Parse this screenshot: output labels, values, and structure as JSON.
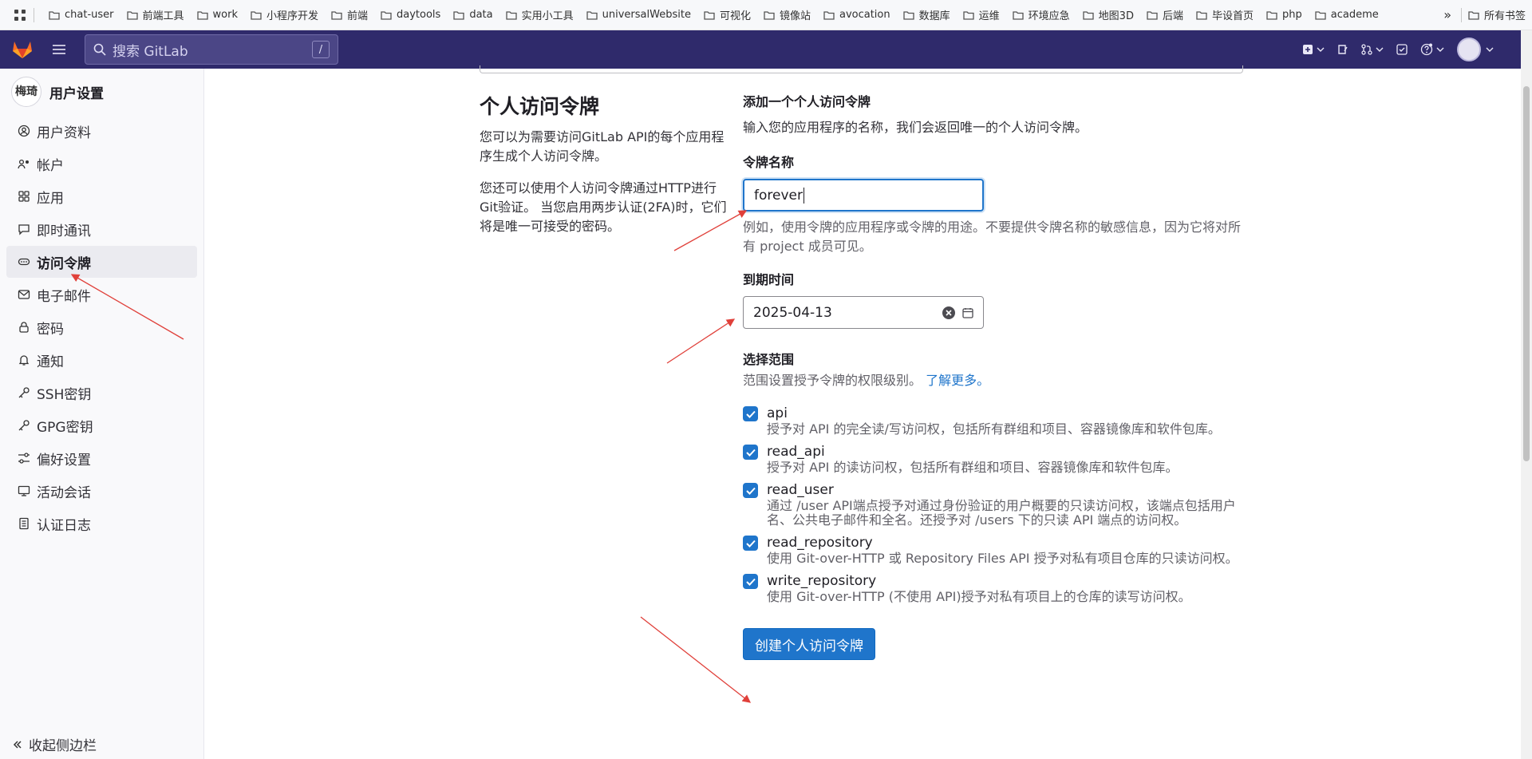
{
  "bookmarks": {
    "items": [
      "chat-user",
      "前端工具",
      "work",
      "小程序开发",
      "前端",
      "daytools",
      "data",
      "实用小工具",
      "universalWebsite",
      "可视化",
      "镜像站",
      "avocation",
      "数据库",
      "运维",
      "环境应急",
      "地图3D",
      "后端",
      "毕设首页",
      "php",
      "academe"
    ],
    "all_label": "所有书签"
  },
  "header": {
    "search_placeholder": "搜索 GitLab",
    "search_shortcut": "/"
  },
  "sidebar": {
    "avatar_text": "梅琦",
    "title": "用户设置",
    "items": [
      {
        "label": "用户资料",
        "icon": "profile-icon"
      },
      {
        "label": "帐户",
        "icon": "account-icon"
      },
      {
        "label": "应用",
        "icon": "applications-icon"
      },
      {
        "label": "即时通讯",
        "icon": "chat-icon"
      },
      {
        "label": "访问令牌",
        "icon": "token-icon",
        "active": true
      },
      {
        "label": "电子邮件",
        "icon": "mail-icon"
      },
      {
        "label": "密码",
        "icon": "lock-icon"
      },
      {
        "label": "通知",
        "icon": "bell-icon"
      },
      {
        "label": "SSH密钥",
        "icon": "key-icon"
      },
      {
        "label": "GPG密钥",
        "icon": "key-icon"
      },
      {
        "label": "偏好设置",
        "icon": "preferences-icon"
      },
      {
        "label": "活动会话",
        "icon": "monitor-icon"
      },
      {
        "label": "认证日志",
        "icon": "log-icon"
      }
    ],
    "collapse_label": "收起侧边栏"
  },
  "intro": {
    "title": "个人访问令牌",
    "p1": "您可以为需要访问GitLab API的每个应用程序生成个人访问令牌。",
    "p2": "您还可以使用个人访问令牌通过HTTP进行Git验证。 当您启用两步认证(2FA)时，它们将是唯一可接受的密码。"
  },
  "form": {
    "title": "添加一个个人访问令牌",
    "desc": "输入您的应用程序的名称，我们会返回唯一的个人访问令牌。",
    "name_label": "令牌名称",
    "name_value": "forever",
    "name_hint": "例如，使用令牌的应用程序或令牌的用途。不要提供令牌名称的敏感信息，因为它将对所有 project 成员可见。",
    "expiry_label": "到期时间",
    "expiry_value": "2025-04-13",
    "scope_label": "选择范围",
    "scope_desc": "范围设置授予令牌的权限级别。",
    "scope_link": "了解更多。",
    "scopes": [
      {
        "name": "api",
        "help": "授予对 API 的完全读/写访问权，包括所有群组和项目、容器镜像库和软件包库。",
        "checked": true
      },
      {
        "name": "read_api",
        "help": "授予对 API 的读访问权，包括所有群组和项目、容器镜像库和软件包库。",
        "checked": true
      },
      {
        "name": "read_user",
        "help": "通过 /user API端点授予对通过身份验证的用户概要的只读访问权，该端点包括用户名、公共电子邮件和全名。还授予对 /users 下的只读 API 端点的访问权。",
        "checked": true
      },
      {
        "name": "read_repository",
        "help": "使用 Git-over-HTTP 或 Repository Files API 授予对私有项目仓库的只读访问权。",
        "checked": true
      },
      {
        "name": "write_repository",
        "help": "使用 Git-over-HTTP (不使用 API)授予对私有项目上的仓库的读写访问权。",
        "checked": true
      }
    ],
    "submit_label": "创建个人访问令牌"
  },
  "colors": {
    "header_bg": "#2f2a6b",
    "primary": "#1f75cb",
    "annotation": "#e0403a"
  }
}
